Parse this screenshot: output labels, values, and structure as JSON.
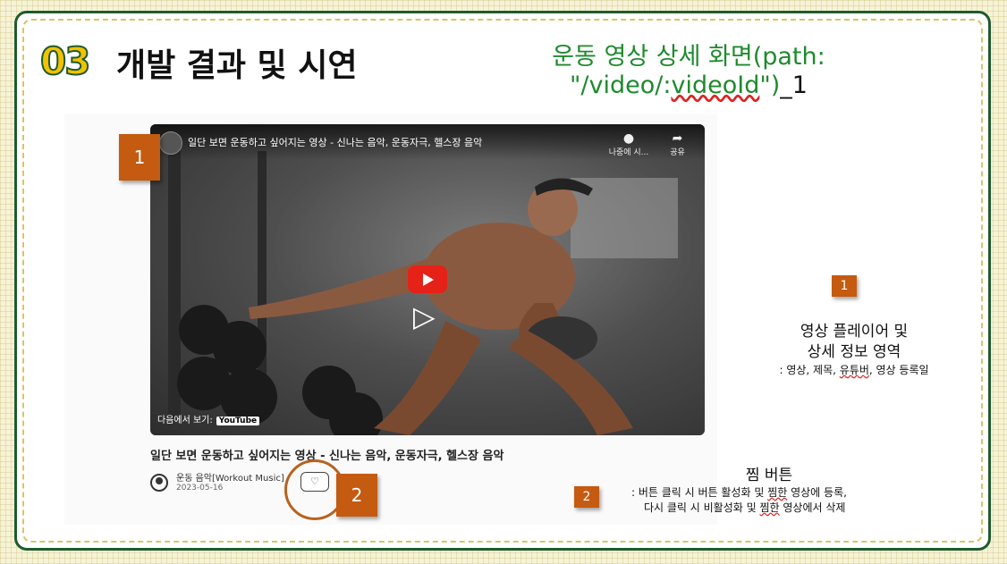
{
  "header": {
    "number": "03",
    "title": "개발 결과 및 시연",
    "subtitle_line1": "운동 영상 상세 화면(path:",
    "subtitle_line2_pre": "\"/video/:",
    "subtitle_line2_wavy": "videoId",
    "subtitle_line2_post": "\")",
    "subtitle_suffix": "_1"
  },
  "player": {
    "title": "일단 보면 운동하고 싶어지는 영상 - 신나는 음악, 운동자극, 헬스장 음악",
    "watch_later": "나중에 시...",
    "share": "공유",
    "watch_on": "다음에서 보기:",
    "youtube_logo": "YouTube"
  },
  "video_info": {
    "title": "일단 보면 운동하고 싶어지는 영상 - 신나는 음악, 운동자극, 헬스장 음악",
    "channel": "운동 음악[Workout Music]",
    "date": "2023-05-16"
  },
  "markers": {
    "m1": "1",
    "m2": "2",
    "m3": "1",
    "m4": "2"
  },
  "desc1": {
    "line1": "영상 플레이어 및",
    "line2": "상세 정보 영역",
    "line3_pre": ": 영상, 제목, ",
    "line3_wavy": "유튜버",
    "line3_post": ", 영상 등록일"
  },
  "desc2": {
    "title": "찜 버튼",
    "line1_pre": ": 버튼 클릭 시 버튼 활성화 및 ",
    "line1_wavy": "찜한",
    "line1_post": " 영상에 등록,",
    "line2_pre": "다시 클릭 시 비활성화 및 ",
    "line2_wavy": "찜한",
    "line2_post": " 영상에서 삭제"
  },
  "colors": {
    "accent_green": "#1f8a2e",
    "frame_green": "#1f5a2e",
    "marker_orange": "#c55a11",
    "badge_yellow": "#f2c200",
    "youtube_red": "#e62117"
  }
}
